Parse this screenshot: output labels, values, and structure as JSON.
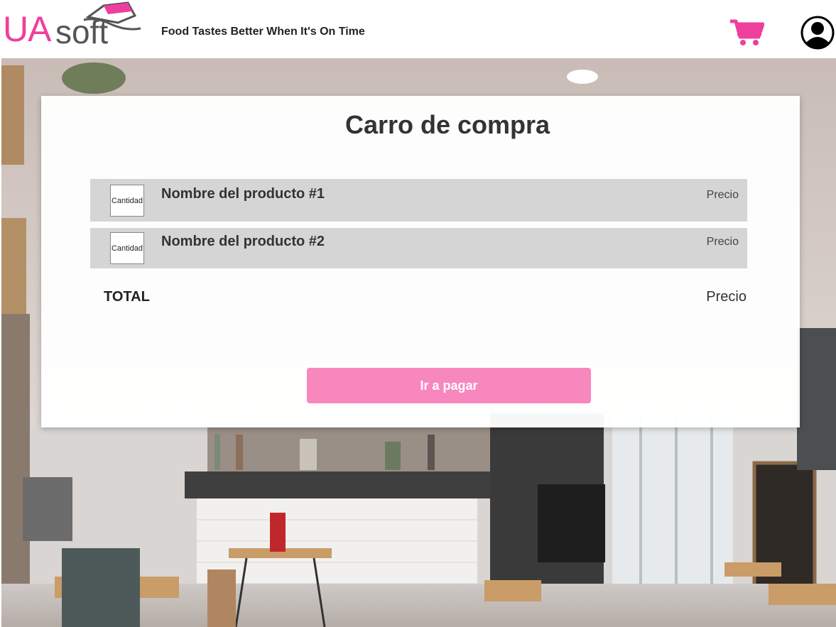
{
  "brand": {
    "logo_primary": "UA",
    "logo_secondary": "soft",
    "tagline": "Food Tastes Better When It's On Time",
    "accent_color": "#ee3f9d"
  },
  "header": {
    "cart_icon": "shopping-cart-icon",
    "user_icon": "user-account-icon"
  },
  "cart": {
    "title": "Carro de compra",
    "items": [
      {
        "quantity_label": "Cantidad",
        "name": "Nombre del producto #1",
        "price": "Precio"
      },
      {
        "quantity_label": "Cantidad",
        "name": "Nombre del producto #2",
        "price": "Precio"
      }
    ],
    "total_label": "TOTAL",
    "total_value": "Precio",
    "pay_button": "Ir a pagar",
    "pay_button_color": "#f887be"
  }
}
